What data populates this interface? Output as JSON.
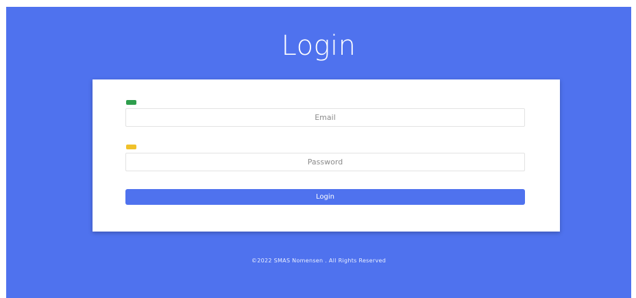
{
  "page": {
    "title": "Login",
    "background_color": "#4f72ee"
  },
  "form": {
    "email": {
      "placeholder": "Email",
      "value": "",
      "indicator_color": "#2e9e4d"
    },
    "password": {
      "placeholder": "Password",
      "value": "",
      "indicator_color": "#f0c12a"
    },
    "submit_label": "Login",
    "submit_color": "#4f72ee"
  },
  "footer": {
    "copyright": "©2022 SMAS Nomensen . All Rights Reserved"
  }
}
